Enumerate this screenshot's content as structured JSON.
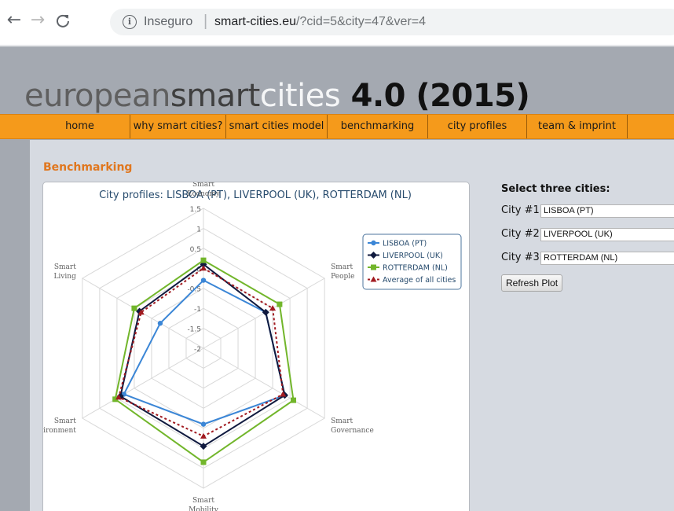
{
  "browser": {
    "back_icon": "←",
    "forward_icon": "→",
    "reload_icon": "C",
    "info_icon": "i",
    "security_label": "Inseguro",
    "url_host": "smart-cities.eu",
    "url_path": "/?cid=5&city=47&ver=4"
  },
  "site": {
    "logo": {
      "part1": "european",
      "part2": "smart",
      "part3": "cities",
      "version": " 4.0 (2015)"
    },
    "menu": [
      {
        "label": "home"
      },
      {
        "label": "why smart cities?"
      },
      {
        "label": "smart cities model"
      },
      {
        "label": "benchmarking"
      },
      {
        "label": "city profiles"
      },
      {
        "label": "team & imprint"
      }
    ],
    "colors": {
      "accent": "#f59a1b",
      "section_title": "#e0771f",
      "header_bg": "#a4a9b1",
      "content_bg": "#d6dae1"
    }
  },
  "main": {
    "section_title": "Benchmarking"
  },
  "form": {
    "heading": "Select three cities:",
    "city1_label": "City #1:",
    "city1_value": "LISBOA (PT)",
    "city2_label": "City #2:",
    "city2_value": "LIVERPOOL (UK)",
    "city3_label": "City #3:",
    "city3_value": "ROTTERDAM (NL)",
    "refresh_label": "Refresh Plot"
  },
  "chart_data": {
    "type": "radar",
    "title": "City profiles: LISBOA (PT), LIVERPOOL (UK), ROTTERDAM (NL)",
    "axes": [
      [
        "Smart",
        "Economy"
      ],
      [
        "Smart",
        "People"
      ],
      [
        "Smart",
        "Governance"
      ],
      [
        "Smart",
        "Mobility"
      ],
      [
        "Smart",
        "Environment"
      ],
      [
        "Smart",
        "Living"
      ]
    ],
    "range": [
      -2,
      1.5
    ],
    "ticks": [
      "1.5",
      "1",
      "0.5",
      "0",
      "-0.5",
      "-1",
      "-1.5",
      "-2"
    ],
    "grid": true,
    "legend_position": "top-right",
    "series": [
      {
        "name": "LISBOA (PT)",
        "color": "#3b86d6",
        "marker": "circle",
        "dash": "none",
        "values": [
          -0.3,
          -0.2,
          0.35,
          -0.1,
          0.3,
          -0.75
        ]
      },
      {
        "name": "LIVERPOOL (UK)",
        "color": "#101a3f",
        "marker": "diamond",
        "dash": "none",
        "values": [
          0.1,
          -0.2,
          0.35,
          0.45,
          0.4,
          -0.15
        ]
      },
      {
        "name": "ROTTERDAM (NL)",
        "color": "#72b62b",
        "marker": "square",
        "dash": "none",
        "values": [
          0.2,
          0.2,
          0.6,
          0.85,
          0.55,
          0.0
        ]
      },
      {
        "name": "Average of all cities",
        "color": "#a11a20",
        "marker": "triangle",
        "dash": "3,3",
        "values": [
          0.0,
          0.0,
          0.3,
          0.2,
          0.45,
          -0.2
        ]
      }
    ]
  }
}
